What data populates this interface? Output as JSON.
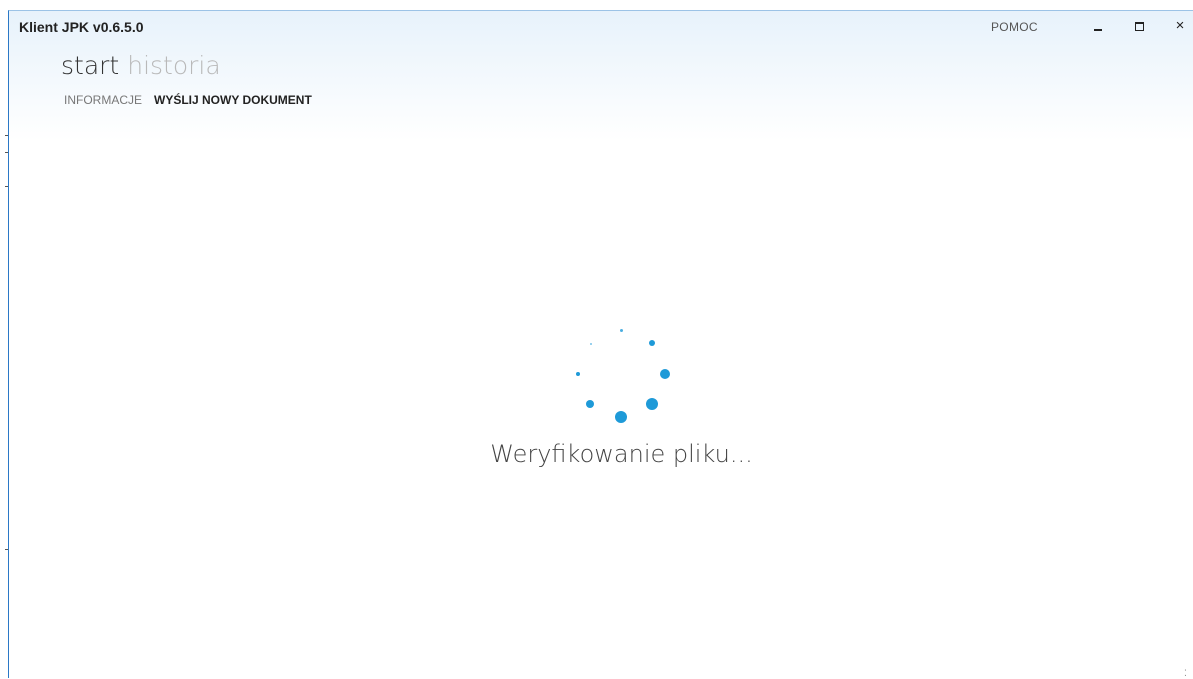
{
  "window": {
    "title": "Klient JPK v0.6.5.0"
  },
  "header": {
    "help_label": "POMOC",
    "controls": {
      "minimize": "minimize",
      "maximize": "maximize",
      "close": "×"
    }
  },
  "nav": {
    "main": [
      {
        "label": "start",
        "active": true
      },
      {
        "label": "historia",
        "active": false
      }
    ],
    "sub": [
      {
        "label": "INFORMACJE",
        "active": false
      },
      {
        "label": "WYŚLIJ NOWY DOKUMENT",
        "active": true
      }
    ]
  },
  "status": {
    "message": "Weryfikowanie pliku..."
  },
  "colors": {
    "accent": "#1e9ad8",
    "border": "#2b78c6"
  }
}
